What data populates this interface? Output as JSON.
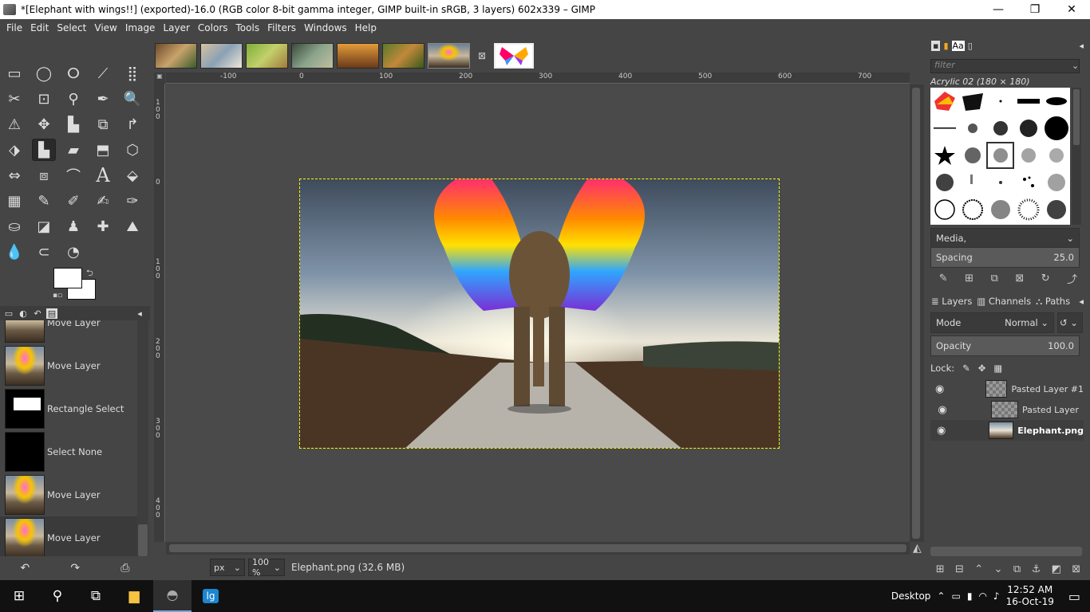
{
  "window": {
    "title": "*[Elephant with wings!!] (exported)-16.0 (RGB color 8-bit gamma integer, GIMP built-in sRGB, 3 layers) 602x339 – GIMP",
    "minimize": "—",
    "maximize": "❐",
    "close": "✕"
  },
  "menu": [
    "File",
    "Edit",
    "Select",
    "View",
    "Image",
    "Layer",
    "Colors",
    "Tools",
    "Filters",
    "Windows",
    "Help"
  ],
  "tools": [
    [
      "▭",
      "◯",
      "ⵔ",
      "⟋",
      "⣿"
    ],
    [
      "✂",
      "⊡",
      "⚲",
      "✒",
      "🔍"
    ],
    [
      "⚠",
      "✥",
      "▙",
      "⧉",
      "↱"
    ],
    [
      "⬗",
      "▙",
      "▰",
      "⬒",
      "⬡"
    ],
    [
      "⇔",
      "⧈",
      "⌒",
      "A",
      "⬙"
    ],
    [
      "▦",
      "✎",
      "✐",
      "✍",
      "✑"
    ],
    [
      "⛀",
      "◪",
      "♟",
      "✚",
      "⛰"
    ],
    [
      "💧",
      "⊂",
      "◔"
    ]
  ],
  "undo_history": [
    {
      "label": "Move Layer"
    },
    {
      "label": "Move Layer"
    },
    {
      "label": "Rectangle Select"
    },
    {
      "label": "Select None"
    },
    {
      "label": "Move Layer"
    },
    {
      "label": "Move Layer"
    }
  ],
  "ruler_top": [
    "-100",
    "0",
    "100",
    "200",
    "300",
    "400",
    "500",
    "600",
    "700"
  ],
  "ruler_left": [
    "1\n0\n0",
    "0",
    "1\n0\n0",
    "2\n0\n0",
    "3\n0\n0",
    "4\n0\n0"
  ],
  "status": {
    "unit": "px",
    "zoom": "100 %",
    "text": "Elephant.png (32.6 MB)"
  },
  "brushes": {
    "filter_placeholder": "filter",
    "selected": "Acrylic 02 (180 × 180)",
    "tag": "Media,",
    "spacing_label": "Spacing",
    "spacing_value": "25.0"
  },
  "layers_panel": {
    "tabs": [
      "Layers",
      "Channels",
      "Paths"
    ],
    "mode_label": "Mode",
    "mode_value": "Normal",
    "opacity_label": "Opacity",
    "opacity_value": "100.0",
    "lock_label": "Lock:",
    "layers": [
      {
        "name": "Pasted Layer #1"
      },
      {
        "name": "Pasted Layer"
      },
      {
        "name": "Elephant.png"
      }
    ]
  },
  "taskbar": {
    "desktop_label": "Desktop",
    "time": "12:52 AM",
    "date": "16-Oct-19"
  }
}
